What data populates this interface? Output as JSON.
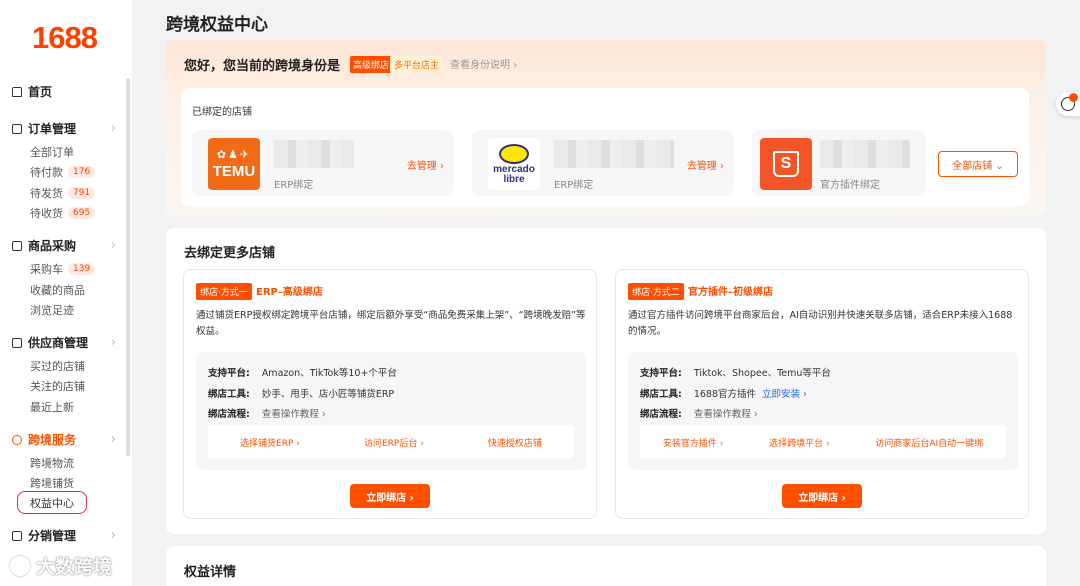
{
  "sidebar": {
    "logo": "1688",
    "home": "首页",
    "groups": [
      {
        "label": "订单管理",
        "items": [
          {
            "label": "全部订单"
          },
          {
            "label": "待付款",
            "count": "176"
          },
          {
            "label": "待发货",
            "count": "791"
          },
          {
            "label": "待收货",
            "count": "695"
          }
        ]
      },
      {
        "label": "商品采购",
        "items": [
          {
            "label": "采购车",
            "count": "139"
          },
          {
            "label": "收藏的商品"
          },
          {
            "label": "浏览足迹"
          }
        ]
      },
      {
        "label": "供应商管理",
        "items": [
          {
            "label": "买过的店铺"
          },
          {
            "label": "关注的店铺"
          },
          {
            "label": "最近上新"
          }
        ]
      },
      {
        "label": "跨境服务",
        "items": [
          {
            "label": "跨境物流"
          },
          {
            "label": "跨境铺货"
          },
          {
            "label": "权益中心"
          }
        ]
      },
      {
        "label": "分销管理",
        "items": []
      }
    ]
  },
  "watermark": "大数跨境",
  "page": {
    "title": "跨境权益中心"
  },
  "identity": {
    "greeting": "您好，您当前的跨境身份是",
    "level_badge": "高级绑店",
    "role_badge": "多平台店主",
    "explain_link": "查看身份说明 ›"
  },
  "bound": {
    "title": "已绑定的店铺",
    "stores": [
      {
        "platform": "TEMU",
        "kind": "ERP绑定",
        "manage": "去管理 ›"
      },
      {
        "platform": "mercado libre",
        "kind": "ERP绑定",
        "manage": "去管理 ›"
      },
      {
        "platform": "Shopee",
        "kind": "官方插件绑定"
      }
    ],
    "all_stores": "全部店铺 ⌄"
  },
  "more": {
    "title": "去绑定更多店铺",
    "methods": [
      {
        "tag": "绑店·方式一",
        "title": "ERP–高级绑店",
        "desc": "通过铺货ERP授权绑定跨境平台店铺，绑定后额外享受“商品免费采集上架”、“跨境晚发赔”等权益。",
        "platforms_label": "支持平台:",
        "platforms": "Amazon、TikTok等10+个平台",
        "tool_label": "绑店工具:",
        "tool": "妙手、甩手、店小匠等铺货ERP",
        "tool_link": "",
        "flow_label": "绑店流程:",
        "flow": "查看操作教程 ›",
        "steps": [
          "选择铺货ERP ›",
          "访问ERP后台 ›",
          "快速授权店铺"
        ],
        "button": "立即绑店 ›"
      },
      {
        "tag": "绑店·方式二",
        "title": "官方插件–初级绑店",
        "desc": "通过官方插件访问跨境平台商家后台，AI自动识别并快速关联多店铺，适合ERP未接入1688的情况。",
        "platforms_label": "支持平台:",
        "platforms": "Tiktok、Shopee、Temu等平台",
        "tool_label": "绑店工具:",
        "tool": "1688官方插件",
        "tool_link": "立即安装 ›",
        "flow_label": "绑店流程:",
        "flow": "查看操作教程 ›",
        "steps": [
          "安装官方插件 ›",
          "选择跨境平台 ›",
          "访问商家后台AI自动一键绑"
        ],
        "button": "立即绑店 ›"
      }
    ]
  },
  "detail": {
    "title": "权益详情"
  },
  "colors": {
    "accent": "#ff5000",
    "link": "#1a66ff"
  }
}
